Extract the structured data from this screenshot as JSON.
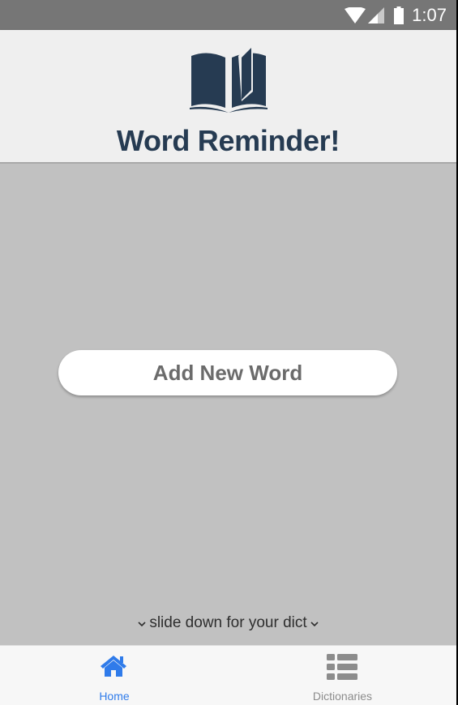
{
  "status_bar": {
    "time": "1:07",
    "icons": [
      "wifi-icon",
      "cellular-signal-icon",
      "battery-icon"
    ]
  },
  "header": {
    "title": "Word Reminder!",
    "logo_icon": "open-book-icon",
    "title_color": "#263b52"
  },
  "main": {
    "add_word_label": "Add New Word",
    "slide_hint": "slide down for your dict",
    "hint_icon": "chevron-down-icon"
  },
  "bottom_nav": {
    "tabs": [
      {
        "label": "Home",
        "icon": "home-icon",
        "active": true
      },
      {
        "label": "Dictionaries",
        "icon": "list-icon",
        "active": false
      }
    ],
    "active_color": "#2f7bea",
    "inactive_color": "#8c8c8c"
  }
}
